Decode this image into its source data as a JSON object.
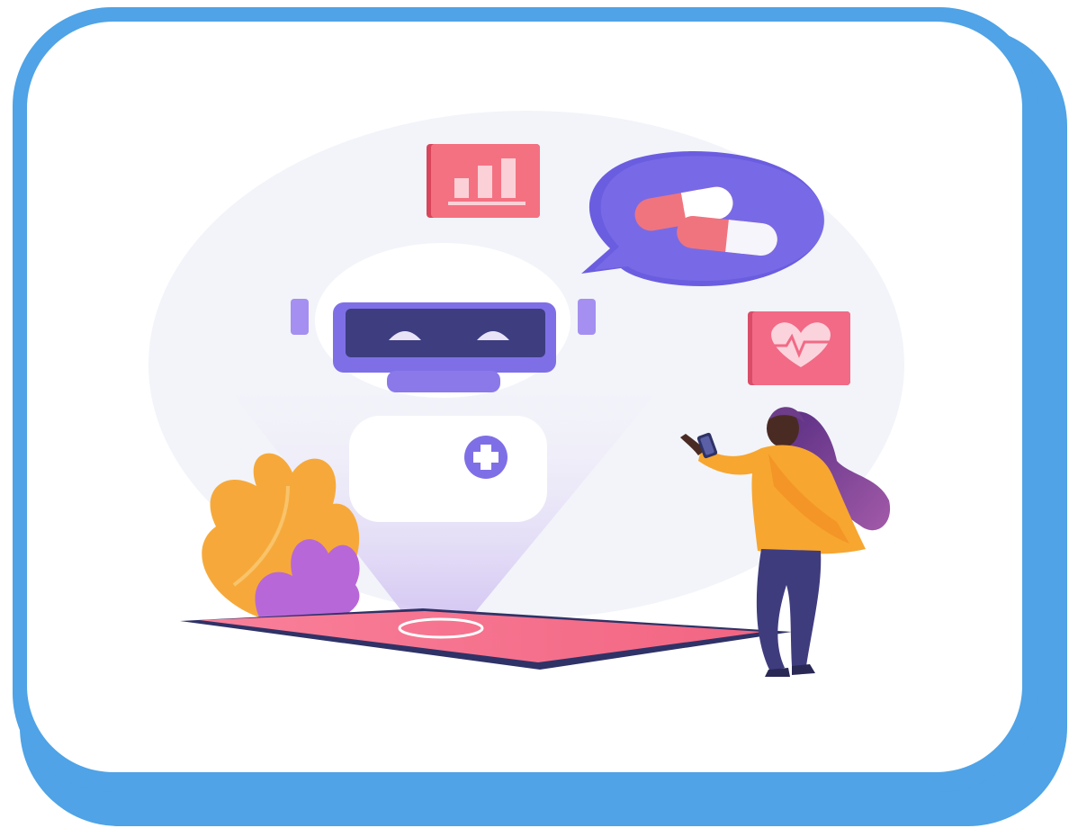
{
  "illustration": {
    "subject": "medical-chatbot-assistant",
    "elements": [
      "robot-assistant-icon",
      "bar-chart-icon",
      "pills-speech-bubble-icon",
      "heart-rate-icon",
      "medical-cross-icon",
      "smartphone",
      "tablet-device",
      "decorative-plant",
      "woman-figure"
    ]
  },
  "colors": {
    "frame_blue": "#4fa3e6",
    "card_white": "#ffffff",
    "backdrop_circle": "#f2f4f9",
    "robot_purple": "#7f6fe6",
    "robot_screen": "#3d3d80",
    "chart_pink": "#f47181",
    "bubble_purple": "#6b5de0",
    "pill_pink": "#f0747e",
    "heart_pink": "#f26a86",
    "tablet_screen": "#f5798f",
    "tablet_body": "#2f3266",
    "plant_orange": "#f6a93a",
    "plant_purple": "#b867d8",
    "jacket_orange": "#f7a630",
    "pants_navy": "#3f3c7e",
    "hair_purple": "#7e3c92"
  }
}
